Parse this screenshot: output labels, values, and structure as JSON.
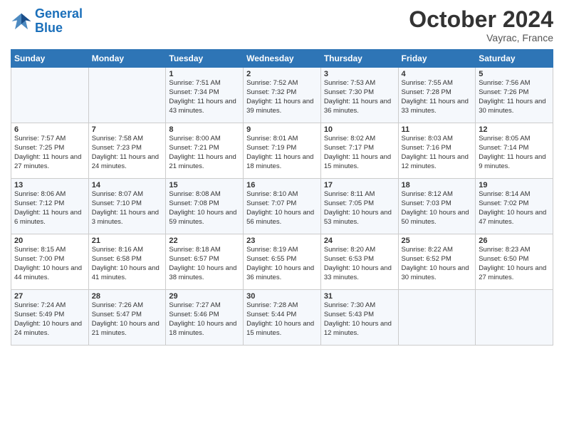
{
  "logo": {
    "line1": "General",
    "line2": "Blue"
  },
  "title": "October 2024",
  "location": "Vayrac, France",
  "days_header": [
    "Sunday",
    "Monday",
    "Tuesday",
    "Wednesday",
    "Thursday",
    "Friday",
    "Saturday"
  ],
  "rows": [
    [
      {
        "day": "",
        "content": ""
      },
      {
        "day": "",
        "content": ""
      },
      {
        "day": "1",
        "content": "Sunrise: 7:51 AM\nSunset: 7:34 PM\nDaylight: 11 hours and 43 minutes."
      },
      {
        "day": "2",
        "content": "Sunrise: 7:52 AM\nSunset: 7:32 PM\nDaylight: 11 hours and 39 minutes."
      },
      {
        "day": "3",
        "content": "Sunrise: 7:53 AM\nSunset: 7:30 PM\nDaylight: 11 hours and 36 minutes."
      },
      {
        "day": "4",
        "content": "Sunrise: 7:55 AM\nSunset: 7:28 PM\nDaylight: 11 hours and 33 minutes."
      },
      {
        "day": "5",
        "content": "Sunrise: 7:56 AM\nSunset: 7:26 PM\nDaylight: 11 hours and 30 minutes."
      }
    ],
    [
      {
        "day": "6",
        "content": "Sunrise: 7:57 AM\nSunset: 7:25 PM\nDaylight: 11 hours and 27 minutes."
      },
      {
        "day": "7",
        "content": "Sunrise: 7:58 AM\nSunset: 7:23 PM\nDaylight: 11 hours and 24 minutes."
      },
      {
        "day": "8",
        "content": "Sunrise: 8:00 AM\nSunset: 7:21 PM\nDaylight: 11 hours and 21 minutes."
      },
      {
        "day": "9",
        "content": "Sunrise: 8:01 AM\nSunset: 7:19 PM\nDaylight: 11 hours and 18 minutes."
      },
      {
        "day": "10",
        "content": "Sunrise: 8:02 AM\nSunset: 7:17 PM\nDaylight: 11 hours and 15 minutes."
      },
      {
        "day": "11",
        "content": "Sunrise: 8:03 AM\nSunset: 7:16 PM\nDaylight: 11 hours and 12 minutes."
      },
      {
        "day": "12",
        "content": "Sunrise: 8:05 AM\nSunset: 7:14 PM\nDaylight: 11 hours and 9 minutes."
      }
    ],
    [
      {
        "day": "13",
        "content": "Sunrise: 8:06 AM\nSunset: 7:12 PM\nDaylight: 11 hours and 6 minutes."
      },
      {
        "day": "14",
        "content": "Sunrise: 8:07 AM\nSunset: 7:10 PM\nDaylight: 11 hours and 3 minutes."
      },
      {
        "day": "15",
        "content": "Sunrise: 8:08 AM\nSunset: 7:08 PM\nDaylight: 10 hours and 59 minutes."
      },
      {
        "day": "16",
        "content": "Sunrise: 8:10 AM\nSunset: 7:07 PM\nDaylight: 10 hours and 56 minutes."
      },
      {
        "day": "17",
        "content": "Sunrise: 8:11 AM\nSunset: 7:05 PM\nDaylight: 10 hours and 53 minutes."
      },
      {
        "day": "18",
        "content": "Sunrise: 8:12 AM\nSunset: 7:03 PM\nDaylight: 10 hours and 50 minutes."
      },
      {
        "day": "19",
        "content": "Sunrise: 8:14 AM\nSunset: 7:02 PM\nDaylight: 10 hours and 47 minutes."
      }
    ],
    [
      {
        "day": "20",
        "content": "Sunrise: 8:15 AM\nSunset: 7:00 PM\nDaylight: 10 hours and 44 minutes."
      },
      {
        "day": "21",
        "content": "Sunrise: 8:16 AM\nSunset: 6:58 PM\nDaylight: 10 hours and 41 minutes."
      },
      {
        "day": "22",
        "content": "Sunrise: 8:18 AM\nSunset: 6:57 PM\nDaylight: 10 hours and 38 minutes."
      },
      {
        "day": "23",
        "content": "Sunrise: 8:19 AM\nSunset: 6:55 PM\nDaylight: 10 hours and 36 minutes."
      },
      {
        "day": "24",
        "content": "Sunrise: 8:20 AM\nSunset: 6:53 PM\nDaylight: 10 hours and 33 minutes."
      },
      {
        "day": "25",
        "content": "Sunrise: 8:22 AM\nSunset: 6:52 PM\nDaylight: 10 hours and 30 minutes."
      },
      {
        "day": "26",
        "content": "Sunrise: 8:23 AM\nSunset: 6:50 PM\nDaylight: 10 hours and 27 minutes."
      }
    ],
    [
      {
        "day": "27",
        "content": "Sunrise: 7:24 AM\nSunset: 5:49 PM\nDaylight: 10 hours and 24 minutes."
      },
      {
        "day": "28",
        "content": "Sunrise: 7:26 AM\nSunset: 5:47 PM\nDaylight: 10 hours and 21 minutes."
      },
      {
        "day": "29",
        "content": "Sunrise: 7:27 AM\nSunset: 5:46 PM\nDaylight: 10 hours and 18 minutes."
      },
      {
        "day": "30",
        "content": "Sunrise: 7:28 AM\nSunset: 5:44 PM\nDaylight: 10 hours and 15 minutes."
      },
      {
        "day": "31",
        "content": "Sunrise: 7:30 AM\nSunset: 5:43 PM\nDaylight: 10 hours and 12 minutes."
      },
      {
        "day": "",
        "content": ""
      },
      {
        "day": "",
        "content": ""
      }
    ]
  ]
}
